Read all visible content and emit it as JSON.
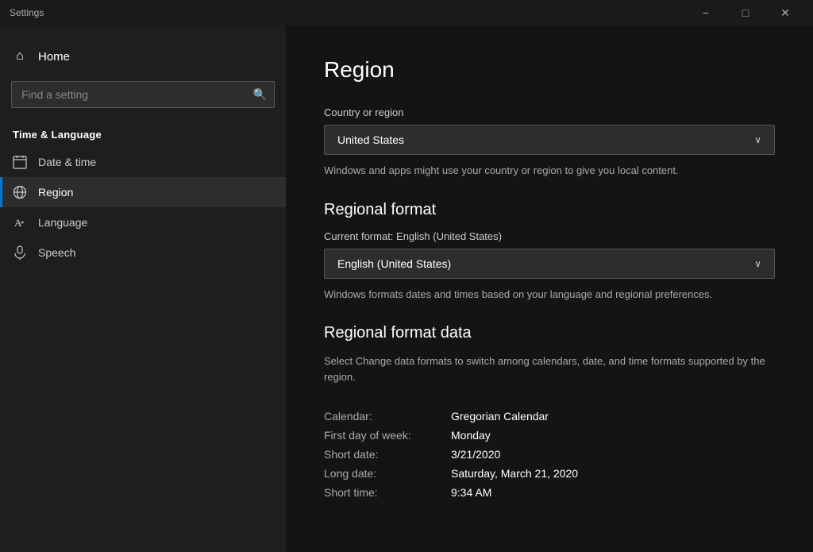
{
  "titlebar": {
    "title": "Settings",
    "minimize_label": "−",
    "restore_label": "□",
    "close_label": "✕"
  },
  "sidebar": {
    "home_label": "Home",
    "search_placeholder": "Find a setting",
    "section_title": "Time & Language",
    "items": [
      {
        "id": "date-time",
        "label": "Date & time",
        "icon": "🗓"
      },
      {
        "id": "region",
        "label": "Region",
        "icon": "🌐",
        "active": true
      },
      {
        "id": "language",
        "label": "Language",
        "icon": "✒"
      },
      {
        "id": "speech",
        "label": "Speech",
        "icon": "🎤"
      }
    ]
  },
  "content": {
    "page_title": "Region",
    "country_section": {
      "label": "Country or region",
      "value": "United States",
      "description": "Windows and apps might use your country or region to give you local content."
    },
    "regional_format_section": {
      "heading": "Regional format",
      "current_format_label": "Current format: English (United States)",
      "value": "English (United States)",
      "description": "Windows formats dates and times based on your language and regional preferences."
    },
    "regional_format_data_section": {
      "heading": "Regional format data",
      "description": "Select Change data formats to switch among calendars, date, and time formats supported by the region.",
      "rows": [
        {
          "key": "Calendar:",
          "value": "Gregorian Calendar"
        },
        {
          "key": "First day of week:",
          "value": "Monday"
        },
        {
          "key": "Short date:",
          "value": "3/21/2020"
        },
        {
          "key": "Long date:",
          "value": "Saturday, March 21, 2020"
        },
        {
          "key": "Short time:",
          "value": "9:34 AM"
        }
      ]
    }
  }
}
